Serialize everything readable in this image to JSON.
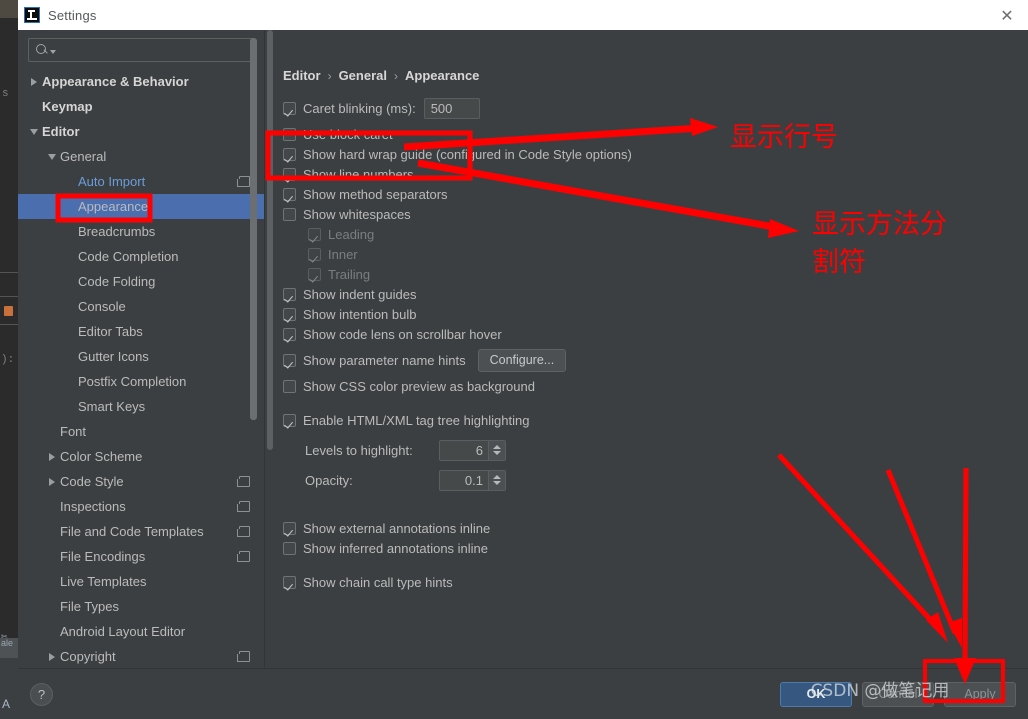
{
  "window": {
    "title": "Settings",
    "app_icon": "intellij-idea-icon",
    "close_icon": "close-icon"
  },
  "search": {
    "placeholder": "",
    "value": "",
    "icon": "search-icon"
  },
  "sidebar": {
    "scrollbar": "tree-scrollbar",
    "items": [
      {
        "label": "Appearance & Behavior",
        "indent": 0,
        "twisty": "collapsed",
        "bold": true,
        "link": false,
        "selected": false,
        "badge": false
      },
      {
        "label": "Keymap",
        "indent": 0,
        "twisty": "none",
        "bold": true,
        "link": false,
        "selected": false,
        "badge": false
      },
      {
        "label": "Editor",
        "indent": 0,
        "twisty": "expanded",
        "bold": true,
        "link": false,
        "selected": false,
        "badge": false
      },
      {
        "label": "General",
        "indent": 1,
        "twisty": "expanded",
        "bold": false,
        "link": false,
        "selected": false,
        "badge": false
      },
      {
        "label": "Auto Import",
        "indent": 2,
        "twisty": "none",
        "bold": false,
        "link": true,
        "selected": false,
        "badge": true
      },
      {
        "label": "Appearance",
        "indent": 2,
        "twisty": "none",
        "bold": false,
        "link": false,
        "selected": true,
        "badge": false
      },
      {
        "label": "Breadcrumbs",
        "indent": 2,
        "twisty": "none",
        "bold": false,
        "link": false,
        "selected": false,
        "badge": false
      },
      {
        "label": "Code Completion",
        "indent": 2,
        "twisty": "none",
        "bold": false,
        "link": false,
        "selected": false,
        "badge": false
      },
      {
        "label": "Code Folding",
        "indent": 2,
        "twisty": "none",
        "bold": false,
        "link": false,
        "selected": false,
        "badge": false
      },
      {
        "label": "Console",
        "indent": 2,
        "twisty": "none",
        "bold": false,
        "link": false,
        "selected": false,
        "badge": false
      },
      {
        "label": "Editor Tabs",
        "indent": 2,
        "twisty": "none",
        "bold": false,
        "link": false,
        "selected": false,
        "badge": false
      },
      {
        "label": "Gutter Icons",
        "indent": 2,
        "twisty": "none",
        "bold": false,
        "link": false,
        "selected": false,
        "badge": false
      },
      {
        "label": "Postfix Completion",
        "indent": 2,
        "twisty": "none",
        "bold": false,
        "link": false,
        "selected": false,
        "badge": false
      },
      {
        "label": "Smart Keys",
        "indent": 2,
        "twisty": "none",
        "bold": false,
        "link": false,
        "selected": false,
        "badge": false
      },
      {
        "label": "Font",
        "indent": 1,
        "twisty": "none",
        "bold": false,
        "link": false,
        "selected": false,
        "badge": false
      },
      {
        "label": "Color Scheme",
        "indent": 1,
        "twisty": "collapsed",
        "bold": false,
        "link": false,
        "selected": false,
        "badge": false
      },
      {
        "label": "Code Style",
        "indent": 1,
        "twisty": "collapsed",
        "bold": false,
        "link": false,
        "selected": false,
        "badge": true
      },
      {
        "label": "Inspections",
        "indent": 1,
        "twisty": "none",
        "bold": false,
        "link": false,
        "selected": false,
        "badge": true
      },
      {
        "label": "File and Code Templates",
        "indent": 1,
        "twisty": "none",
        "bold": false,
        "link": false,
        "selected": false,
        "badge": true
      },
      {
        "label": "File Encodings",
        "indent": 1,
        "twisty": "none",
        "bold": false,
        "link": false,
        "selected": false,
        "badge": true
      },
      {
        "label": "Live Templates",
        "indent": 1,
        "twisty": "none",
        "bold": false,
        "link": false,
        "selected": false,
        "badge": false
      },
      {
        "label": "File Types",
        "indent": 1,
        "twisty": "none",
        "bold": false,
        "link": false,
        "selected": false,
        "badge": false
      },
      {
        "label": "Android Layout Editor",
        "indent": 1,
        "twisty": "none",
        "bold": false,
        "link": false,
        "selected": false,
        "badge": false
      },
      {
        "label": "Copyright",
        "indent": 1,
        "twisty": "collapsed",
        "bold": false,
        "link": false,
        "selected": false,
        "badge": true
      }
    ]
  },
  "main": {
    "breadcrumb": [
      "Editor",
      "General",
      "Appearance"
    ],
    "breadcrumb_separator": "›",
    "options": {
      "caret_blinking_label": "Caret blinking (ms):",
      "caret_blinking_value": "500",
      "use_block_caret": "Use block caret",
      "show_hard_wrap_guide": "Show hard wrap guide (configured in Code Style options)",
      "show_line_numbers": "Show line numbers",
      "show_method_separators": "Show method separators",
      "show_whitespaces": "Show whitespaces",
      "leading": "Leading",
      "inner": "Inner",
      "trailing": "Trailing",
      "show_indent_guides": "Show indent guides",
      "show_intention_bulb": "Show intention bulb",
      "show_code_lens": "Show code lens on scrollbar hover",
      "show_parameter_name_hints": "Show parameter name hints",
      "configure_button": "Configure...",
      "show_css_color_preview": "Show CSS color preview as background",
      "enable_html_xml_tag_tree": "Enable HTML/XML tag tree highlighting",
      "levels_to_highlight_label": "Levels to highlight:",
      "levels_to_highlight_value": "6",
      "opacity_label": "Opacity:",
      "opacity_value": "0.1",
      "show_external_annotations": "Show external annotations inline",
      "show_inferred_annotations": "Show inferred annotations inline",
      "show_chain_call_type_hints": "Show chain call type hints"
    }
  },
  "footer": {
    "help_label": "?",
    "ok": "OK",
    "cancel": "Cancel",
    "apply": "Apply"
  },
  "annotations": {
    "color": "#ff0000",
    "note_line_numbers": "显示行号",
    "note_method_separators_line1": "显示方法分",
    "note_method_separators_line2": "割符"
  },
  "watermark": "CSDN @做笔记用"
}
